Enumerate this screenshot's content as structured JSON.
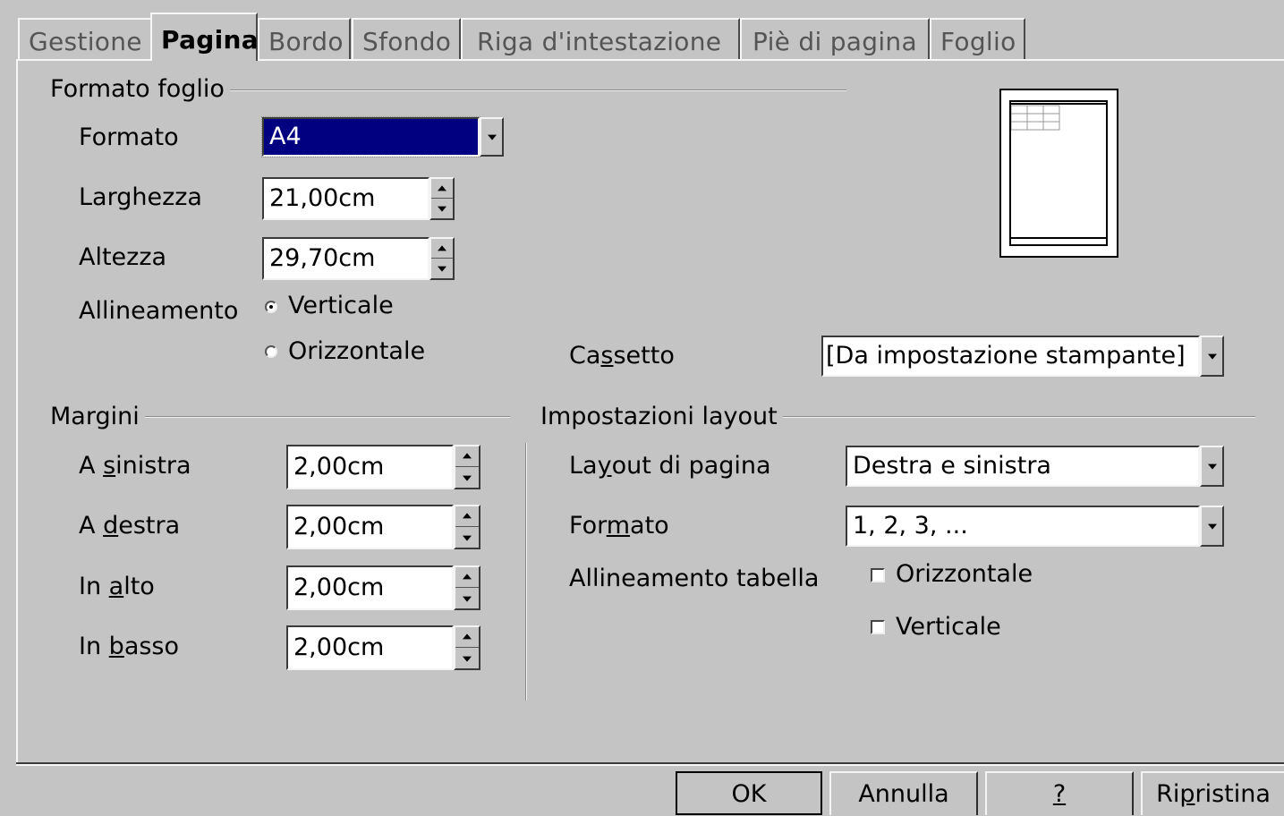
{
  "tabs": [
    "Gestione",
    "Pagina",
    "Bordo",
    "Sfondo",
    "Riga d'intestazione",
    "Piè di pagina",
    "Foglio"
  ],
  "paper_format": {
    "title": "Formato foglio",
    "format_label": "Formato",
    "format_value": "A4",
    "width_label": "Larghezza",
    "width_value": "21,00cm",
    "height_label": "Altezza",
    "height_value": "29,70cm",
    "orientation_label": "Allineamento",
    "orientation_options": [
      "Verticale",
      "Orizzontale"
    ],
    "orientation_selected": "Verticale",
    "tray_label": "Cassetto",
    "tray_value": "[Da impostazione stampante]"
  },
  "margins": {
    "title": "Margini",
    "left_label": "A sinistra",
    "left_value": "2,00cm",
    "right_label": "A destra",
    "right_value": "2,00cm",
    "top_label": "In alto",
    "top_value": "2,00cm",
    "bottom_label": "In basso",
    "bottom_value": "2,00cm"
  },
  "layout_settings": {
    "title": "Impostazioni layout",
    "page_layout_label": "Layout di pagina",
    "page_layout_value": "Destra e sinistra",
    "format_label": "Formato",
    "format_value": "1, 2, 3, ...",
    "table_alignment_label": "Allineamento tabella",
    "table_alignment_options": [
      "Orizzontale",
      "Verticale"
    ]
  },
  "buttons": {
    "ok": "OK",
    "cancel": "Annulla",
    "help": "?",
    "reset": "Ripristina"
  }
}
